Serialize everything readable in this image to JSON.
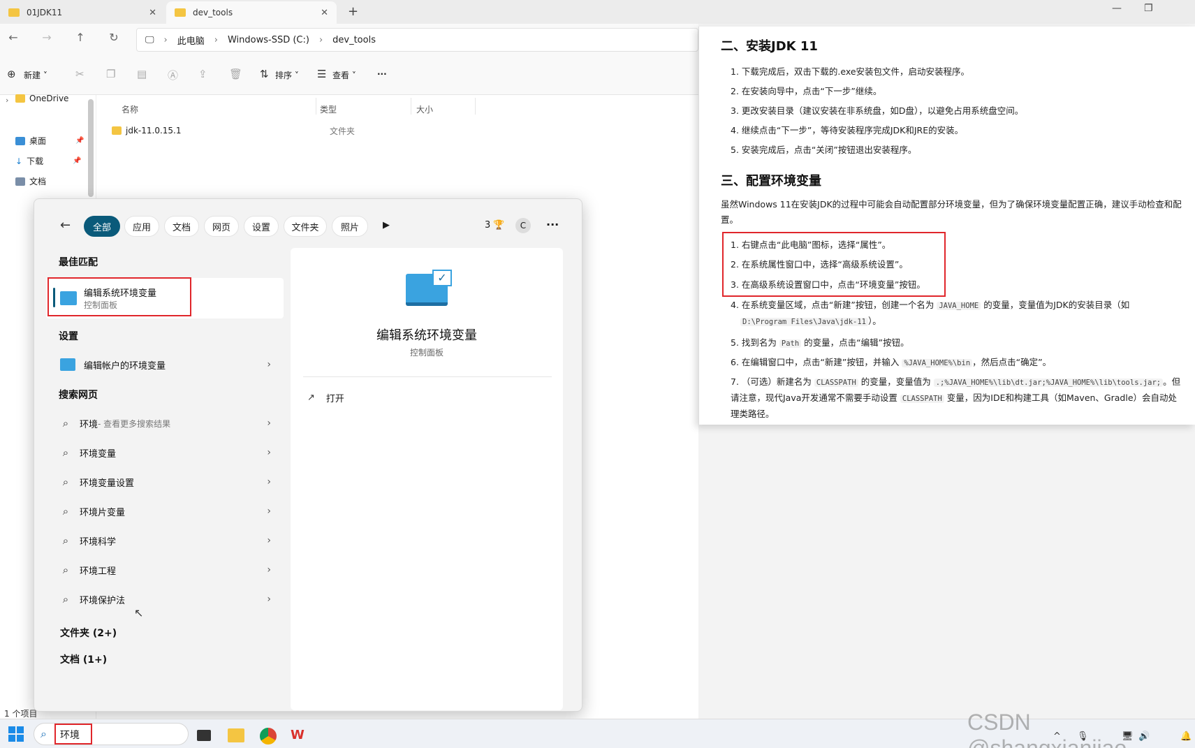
{
  "tabs": [
    {
      "label": "01JDK11"
    },
    {
      "label": "dev_tools"
    }
  ],
  "address": {
    "crumbs": [
      "此电脑",
      "Windows-SSD (C:)",
      "dev_tools"
    ]
  },
  "toolbar": {
    "new_label": "新建",
    "sort_label": "排序",
    "view_label": "查看",
    "more_label": "···"
  },
  "sidebar": {
    "onedrive": "OneDrive",
    "items": [
      "桌面",
      "下载",
      "文档"
    ]
  },
  "columns": {
    "name": "名称",
    "type": "类型",
    "size": "大小"
  },
  "file": {
    "name": "jdk-11.0.15.1",
    "type": "文件夹"
  },
  "status": {
    "count": "1 个项目"
  },
  "search": {
    "filters": [
      "全部",
      "应用",
      "文档",
      "网页",
      "设置",
      "文件夹",
      "照片"
    ],
    "points": "3",
    "avatar": "C",
    "best_match_title": "最佳匹配",
    "best_match": {
      "name": "编辑系统环境变量",
      "sub": "控制面板"
    },
    "settings_title": "设置",
    "settings_item": "编辑帐户的环境变量",
    "web_title": "搜索网页",
    "web_first": {
      "name": "环境",
      "sub": " - 查看更多搜索结果"
    },
    "web_items": [
      "环境变量",
      "环境变量设置",
      "环境片变量",
      "环境科学",
      "环境工程",
      "环境保护法"
    ],
    "folders": "文件夹 (2+)",
    "docs": "文档 (1+)",
    "preview": {
      "name": "编辑系统环境变量",
      "sub": "控制面板",
      "open": "打开"
    },
    "query": "环境"
  },
  "doc": {
    "h2": "二、安装JDK 11",
    "install_steps": [
      "1. 下载完成后，双击下载的.exe安装包文件，启动安装程序。",
      "2. 在安装向导中，点击“下一步”继续。",
      "3. 更改安装目录（建议安装在非系统盘，如D盘），以避免占用系统盘空间。",
      "4. 继续点击“下一步”，等待安装程序完成JDK和JRE的安装。",
      "5. 安装完成后，点击“关闭”按钮退出安装程序。"
    ],
    "h3": "三、配置环境变量",
    "intro": "虽然Windows 11在安装JDK的过程中可能会自动配置部分环境变量，但为了确保环境变量配置正确，建议手动检查和配置。",
    "config_steps": [
      "1. 右键点击“此电脑”图标，选择“属性”。",
      "2. 在系统属性窗口中，选择“高级系统设置”。",
      "3. 在高级系统设置窗口中，点击“环境变量”按钮。"
    ],
    "step4a": "4. 在系统变量区域，点击“新建”按钮，创建一个名为 ",
    "step4_code": "JAVA_HOME",
    "step4b": " 的变量，变量值为JDK的安装目录（如",
    "step4_code2": "D:\\Program Files\\Java\\jdk-11",
    "step4c": "）。",
    "step5a": "5. 找到名为 ",
    "step5_code": "Path",
    "step5b": " 的变量，点击“编辑”按钮。",
    "step6a": "6. 在编辑窗口中，点击“新建”按钮，并输入 ",
    "step6_code": "%JAVA_HOME%\\bin",
    "step6b": "，然后点击“确定”。",
    "step7a": "7. （可选）新建名为 ",
    "step7_code": "CLASSPATH",
    "step7b": " 的变量，变量值为 ",
    "step7_code2": ".;%JAVA_HOME%\\lib\\dt.jar;%JAVA_HOME%\\lib\\tools.jar;",
    "step7c": "。但请注意，现代Java开发通常不需要手动设置 ",
    "step7_code3": "CLASSPATH",
    "step7d": " 变量，因为IDE和构建工具（如Maven、Gradle）会自动处理类路径。"
  },
  "watermark": "CSDN @shangxianjiao",
  "colors": {
    "accent": "#0a5a7a",
    "highlight": "#e0262b"
  }
}
